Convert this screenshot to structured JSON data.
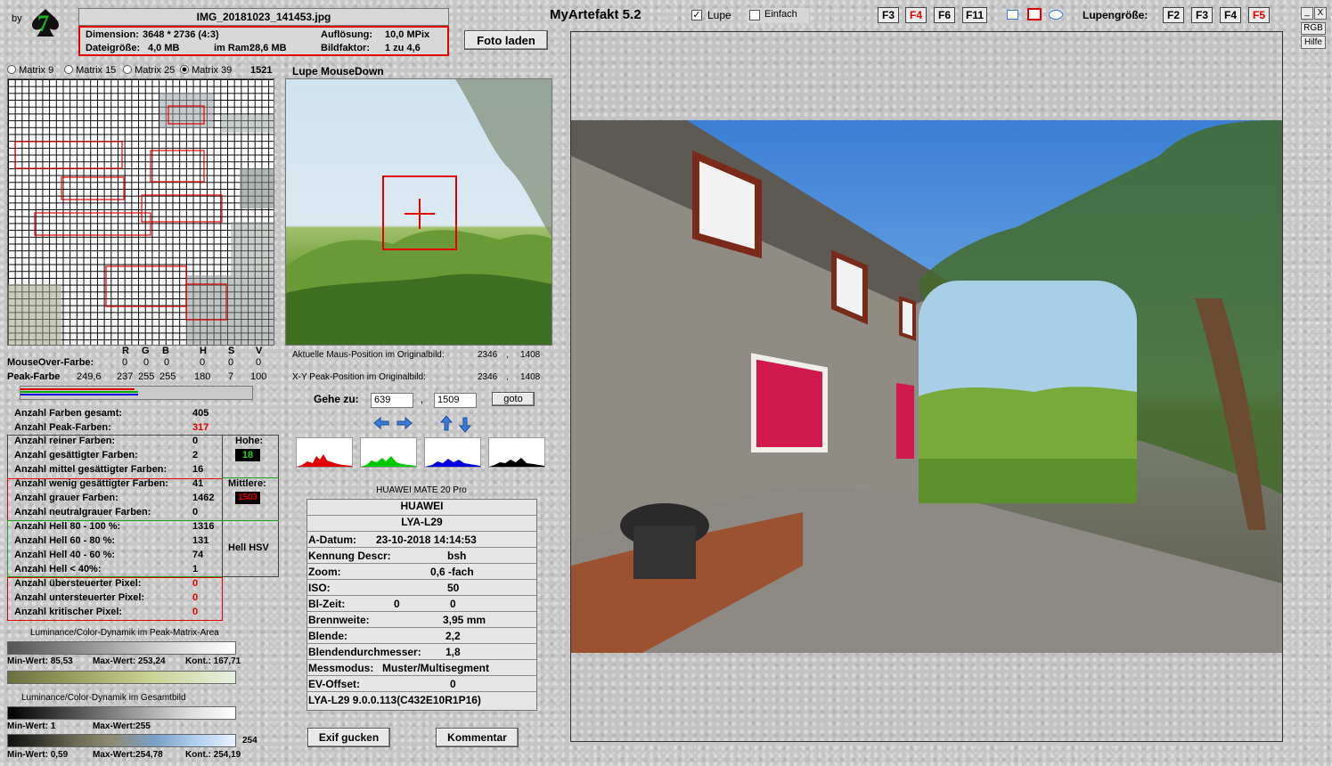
{
  "brand": {
    "by": "by",
    "logo_char": "7"
  },
  "file": {
    "name": "IMG_20181023_141453.jpg",
    "dimension_label": "Dimension:",
    "dimension_value": "3648 * 2736 (4:3)",
    "resolution_label": "Auflösung:",
    "resolution_value": "10,0 MPix",
    "size_label": "Dateigröße:",
    "size_value": "4,0 MB",
    "ram_label": "im Ram:",
    "ram_value": "28,6 MB",
    "factor_label": "Bildfaktor:",
    "factor_value": "1 zu 4,6"
  },
  "foto_laden": "Foto laden",
  "app_title": "MyArtefakt 5.2",
  "lupe_label": "Lupe",
  "einfach_label": "Einfach",
  "fkeys": [
    "F3",
    "F4",
    "F6",
    "F11"
  ],
  "lupen_label": "Lupengröße:",
  "lupen_keys": [
    "F2",
    "F3",
    "F4",
    "F5"
  ],
  "window_buttons": {
    "minimize": "_",
    "close": "X",
    "rgb": "RGB",
    "help": "Hilfe"
  },
  "matrix": {
    "options": [
      "Matrix 9",
      "Matrix 15",
      "Matrix 25",
      "Matrix 39"
    ],
    "selected": "Matrix 39",
    "count": "1521"
  },
  "lupe_title": "Lupe MouseDown",
  "color_table": {
    "headers": [
      "R",
      "G",
      "B",
      "H",
      "S",
      "V"
    ],
    "mouseover_label": "MouseOver-Farbe:",
    "mouseover_values": [
      "0",
      "0",
      "0",
      "0",
      "0",
      "0"
    ],
    "peak_label": "Peak-Farbe",
    "peak_extra": "249,6",
    "peak_values": [
      "237",
      "255",
      "255",
      "180",
      "7",
      "100"
    ]
  },
  "positions": {
    "current_label": "Aktuelle Maus-Position  im Originalbild:",
    "current_x": "2346",
    "current_y": "1408",
    "peak_label": "X-Y Peak-Position  im Originalbild:",
    "peak_x": "2346",
    "peak_y": "1408",
    "sep": ","
  },
  "goto": {
    "label": "Gehe zu:",
    "x": "639",
    "y": "1509",
    "sep": ",",
    "button": "goto"
  },
  "stats": {
    "farben_gesamt_label": "Anzahl Farben gesamt:",
    "farben_gesamt": "405",
    "peak_farben_label": "Anzahl Peak-Farben:",
    "peak_farben": "317",
    "rows": [
      {
        "label": "Anzahl reiner Farben:",
        "value": "0"
      },
      {
        "label": "Anzahl gesättigter Farben:",
        "value": "2"
      },
      {
        "label": "Anzahl mittel gesättigter Farben:",
        "value": "16"
      },
      {
        "label": "Anzahl wenig gesättigter Farben:",
        "value": "41"
      },
      {
        "label": "Anzahl grauer Farben:",
        "value": "1462"
      },
      {
        "label": "Anzahl neutralgrauer Farben:",
        "value": "0"
      },
      {
        "label": "Anzahl Hell 80 - 100 %:",
        "value": "1316"
      },
      {
        "label": "Anzahl Hell 60 - 80 %:",
        "value": "131"
      },
      {
        "label": "Anzahl Hell 40 - 60 %:",
        "value": "74"
      },
      {
        "label": "Anzahl Hell < 40%:",
        "value": "1"
      },
      {
        "label": "Anzahl übersteuerter Pixel:",
        "value": "0"
      },
      {
        "label": "Anzahl untersteuerter Pixel:",
        "value": "0"
      },
      {
        "label": "Anzahl kritischer Pixel:",
        "value": "0"
      }
    ],
    "hohe_label": "Hohe:",
    "hohe_value": "18",
    "mittlere_label": "Mittlere:",
    "mittlere_value": "1503",
    "hell_hsv": "Hell HSV"
  },
  "dynamics": {
    "peak_title": "Luminance/Color-Dynamik im Peak-Matrix-Area",
    "peak_min": "Min-Wert: 85,53",
    "peak_max": "Max-Wert: 253,24",
    "peak_kont": "Kont.: 167,71",
    "total_title": "Luminance/Color-Dynamik im Gesamtbild",
    "total_min": "Min-Wert: 1",
    "total_max": "Max-Wert:255",
    "total_side": "254",
    "total_min2": "Min-Wert: 0,59",
    "total_max2": "Max-Wert:254,78",
    "total_kont2": "Kont.: 254,19"
  },
  "exif": {
    "device": "HUAWEI MATE 20 Pro",
    "make": "HUAWEI",
    "model": "LYA-L29",
    "rows": [
      {
        "label": "A-Datum:",
        "value": "23-10-2018 14:14:53"
      },
      {
        "label": "Kennung Descr:",
        "value": "bsh"
      },
      {
        "label": "Zoom:",
        "value": "0,6 -fach"
      },
      {
        "label": "ISO:",
        "value": "50"
      },
      {
        "label": "Bl-Zeit:",
        "value": "0",
        "value2": "0"
      },
      {
        "label": "Brennweite:",
        "value": "3,95  mm"
      },
      {
        "label": "Blende:",
        "value": "2,2"
      },
      {
        "label": "Blendendurchmesser:",
        "value": "1,8"
      },
      {
        "label": "Messmodus:",
        "value": "Muster/Multisegment"
      },
      {
        "label": "EV-Offset:",
        "value": "0"
      }
    ],
    "firmware": "LYA-L29 9.0.0.113(C432E10R1P16)"
  },
  "buttons": {
    "exif": "Exif gucken",
    "comment": "Kommentar"
  }
}
